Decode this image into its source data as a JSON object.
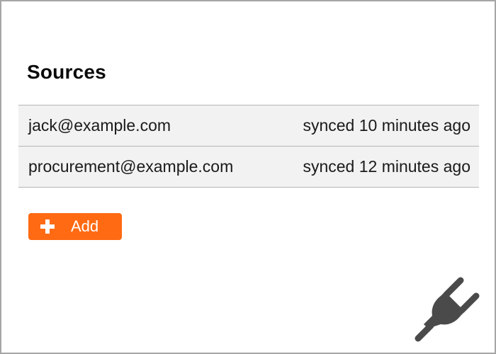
{
  "sources": {
    "title": "Sources",
    "items": [
      {
        "email": "jack@example.com",
        "status": "synced 10 minutes ago"
      },
      {
        "email": "procurement@example.com",
        "status": "synced 12 minutes ago"
      }
    ],
    "add_label": "Add"
  },
  "icons": {
    "add": "plus-icon",
    "decoration": "plug-icon"
  },
  "colors": {
    "accent": "#ff6a13",
    "row_background": "#f2f2f2",
    "icon_gray": "#4a4a4a"
  }
}
